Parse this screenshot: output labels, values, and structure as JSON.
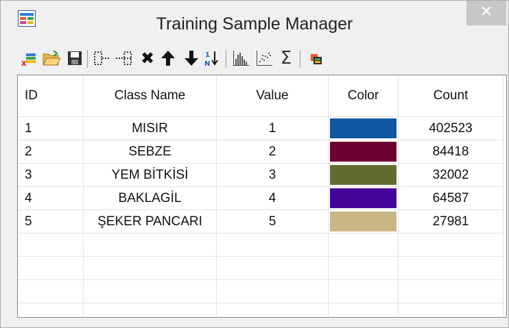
{
  "window": {
    "title": "Training Sample Manager",
    "close_label": "✕"
  },
  "toolbar": {
    "items": [
      {
        "name": "new-class-icon"
      },
      {
        "name": "open-folder-icon"
      },
      {
        "name": "save-icon"
      },
      {
        "name": "merge-classes-icon"
      },
      {
        "name": "split-class-icon"
      },
      {
        "name": "delete-class-icon"
      },
      {
        "name": "move-up-icon"
      },
      {
        "name": "move-down-icon"
      },
      {
        "name": "sort-icon"
      },
      {
        "name": "histogram-icon"
      },
      {
        "name": "scatterplot-icon"
      },
      {
        "name": "statistics-sigma-icon"
      },
      {
        "name": "export-layers-icon"
      }
    ]
  },
  "table": {
    "headers": {
      "id": "ID",
      "class_name": "Class Name",
      "value": "Value",
      "color": "Color",
      "count": "Count"
    },
    "rows": [
      {
        "id": "1",
        "class_name": "MISIR",
        "value": "1",
        "color": "#0f57a0",
        "count": "402523"
      },
      {
        "id": "2",
        "class_name": "SEBZE",
        "value": "2",
        "color": "#6d0230",
        "count": "84418"
      },
      {
        "id": "3",
        "class_name": "YEM BİTKİSİ",
        "value": "3",
        "color": "#646b32",
        "count": "32002"
      },
      {
        "id": "4",
        "class_name": "BAKLAGİL",
        "value": "4",
        "color": "#440598",
        "count": "64587"
      },
      {
        "id": "5",
        "class_name": "ŞEKER PANCARI",
        "value": "5",
        "color": "#c8b886",
        "count": "27981"
      }
    ]
  }
}
